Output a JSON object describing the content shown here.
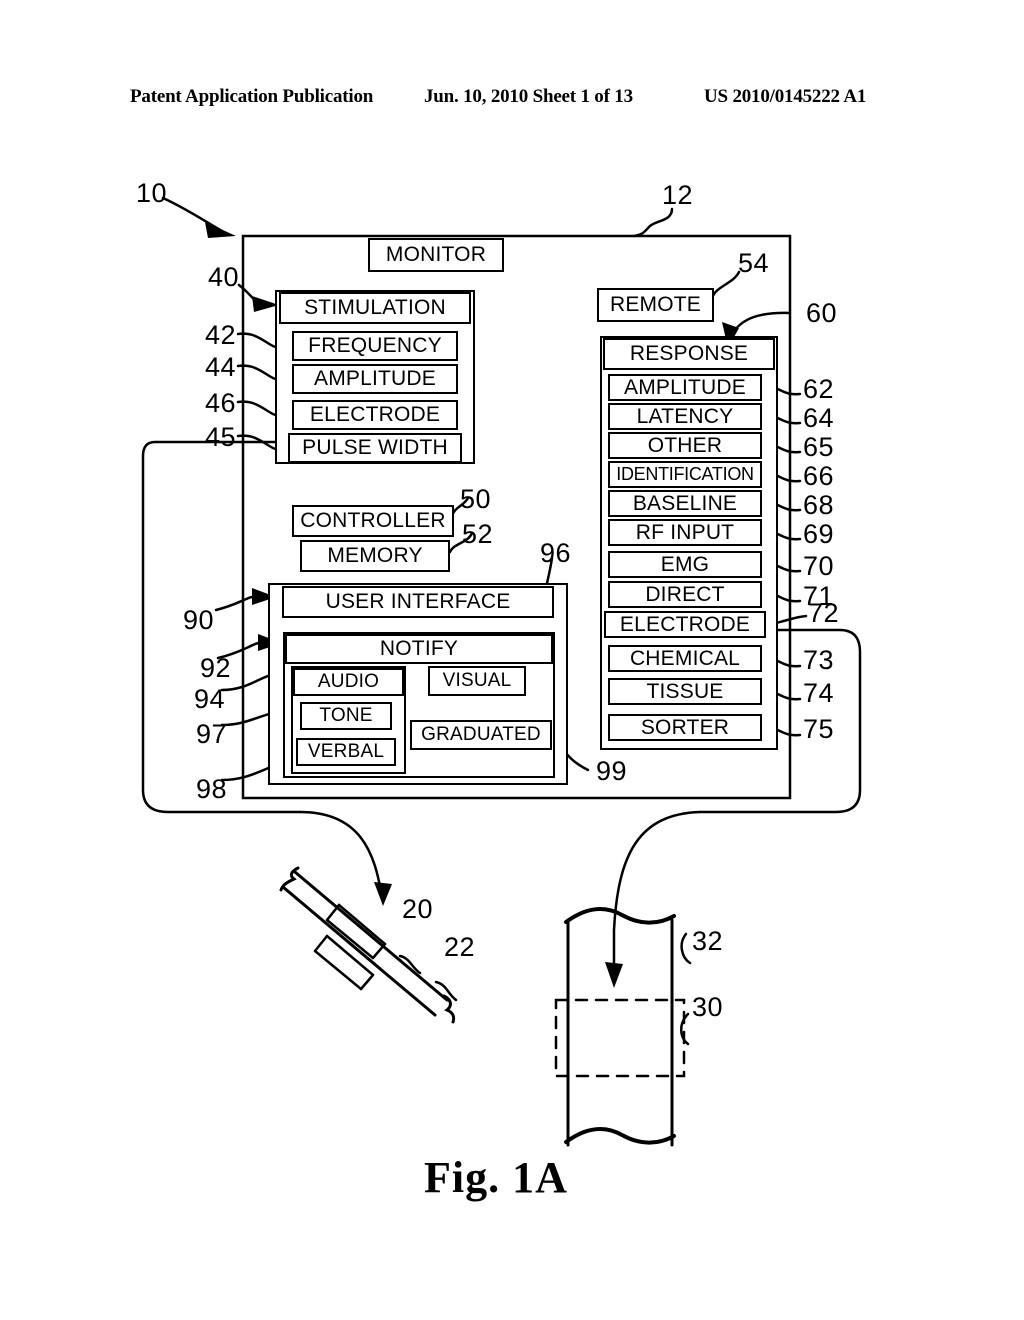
{
  "header": {
    "left": "Patent Application Publication",
    "middle": "Jun. 10, 2010  Sheet 1 of 13",
    "right": "US 2010/0145222 A1"
  },
  "figure": {
    "caption": "Fig. 1A"
  },
  "diagram": {
    "monitor_label": "MONITOR",
    "remote_label": "REMOTE",
    "stimulation": {
      "title": "STIMULATION",
      "items": [
        {
          "label": "FREQUENCY",
          "ref": "42"
        },
        {
          "label": "AMPLITUDE",
          "ref": "44"
        },
        {
          "label": "ELECTRODE",
          "ref": "46"
        },
        {
          "label": "PULSE WIDTH",
          "ref": "45"
        }
      ]
    },
    "response": {
      "title": "RESPONSE",
      "items": [
        {
          "label": "AMPLITUDE",
          "ref": "62"
        },
        {
          "label": "LATENCY",
          "ref": "64"
        },
        {
          "label": "OTHER",
          "ref": "65"
        },
        {
          "label": "IDENTIFICATION",
          "ref": "66"
        },
        {
          "label": "BASELINE",
          "ref": "68"
        },
        {
          "label": "RF INPUT",
          "ref": "69"
        },
        {
          "label": "EMG",
          "ref": "70"
        },
        {
          "label": "DIRECT",
          "ref": "71"
        },
        {
          "label": "ELECTRODE",
          "ref": "72"
        },
        {
          "label": "CHEMICAL",
          "ref": "73"
        },
        {
          "label": "TISSUE",
          "ref": "74"
        },
        {
          "label": "SORTER",
          "ref": "75"
        }
      ]
    },
    "controller_label": "CONTROLLER",
    "memory_label": "MEMORY",
    "user_interface_label": "USER INTERFACE",
    "notify_label": "NOTIFY",
    "audio_label": "AUDIO",
    "tone_label": "TONE",
    "verbal_label": "VERBAL",
    "visual_label": "VISUAL",
    "graduated_label": "GRADUATED"
  },
  "reference_numerals": {
    "system": "10",
    "housing": "12",
    "stimulation": "40",
    "controller": "50",
    "memory": "52",
    "remote": "54",
    "response": "60",
    "user_interface": "90",
    "notify": "92",
    "audio": "94",
    "visual": "96",
    "tone": "97",
    "verbal": "98",
    "graduated": "99",
    "probe": "20",
    "probe_shaft": "22",
    "target_region": "30",
    "tissue": "32"
  }
}
